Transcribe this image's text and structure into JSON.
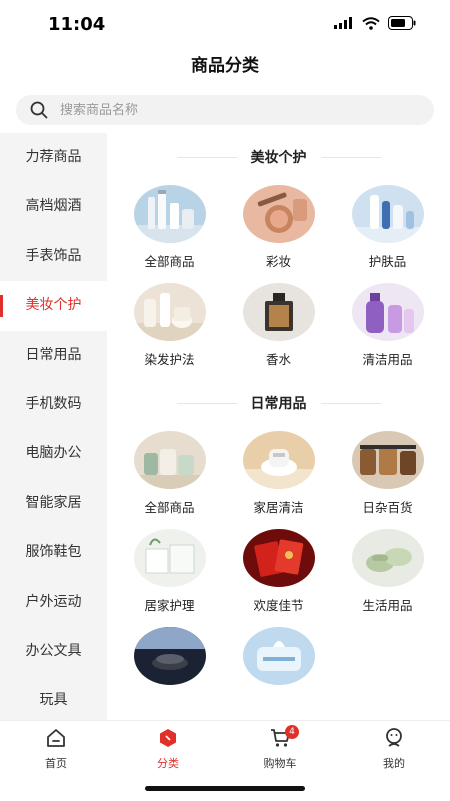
{
  "status": {
    "time": "11:04"
  },
  "header": {
    "title": "商品分类"
  },
  "search": {
    "placeholder": "搜索商品名称"
  },
  "sidebar": {
    "items": [
      {
        "label": "力荐商品"
      },
      {
        "label": "高档烟酒"
      },
      {
        "label": "手表饰品"
      },
      {
        "label": "美妆个护"
      },
      {
        "label": "日常用品"
      },
      {
        "label": "手机数码"
      },
      {
        "label": "电脑办公"
      },
      {
        "label": "智能家居"
      },
      {
        "label": "服饰鞋包"
      },
      {
        "label": "户外运动"
      },
      {
        "label": "办公文具"
      },
      {
        "label": "玩具"
      }
    ],
    "active_index": 3
  },
  "sections": [
    {
      "title": "美妆个护",
      "items": [
        {
          "label": "全部商品",
          "icon": "skincare-set-image"
        },
        {
          "label": "彩妆",
          "icon": "makeup-image"
        },
        {
          "label": "护肤品",
          "icon": "skincare-bottles-image"
        },
        {
          "label": "染发护法",
          "icon": "hair-care-image"
        },
        {
          "label": "香水",
          "icon": "perfume-image"
        },
        {
          "label": "清洁用品",
          "icon": "cleaning-products-image"
        }
      ]
    },
    {
      "title": "日常用品",
      "items": [
        {
          "label": "全部商品",
          "icon": "kitchenware-image"
        },
        {
          "label": "家居清洁",
          "icon": "mite-vacuum-image"
        },
        {
          "label": "日杂百货",
          "icon": "storage-containers-image"
        },
        {
          "label": "居家护理",
          "icon": "tissue-boxes-image"
        },
        {
          "label": "欢度佳节",
          "icon": "red-envelope-image"
        },
        {
          "label": "生活用品",
          "icon": "slippers-image"
        },
        {
          "label": "",
          "icon": "speaker-image"
        },
        {
          "label": "",
          "icon": "wet-wipes-image"
        }
      ]
    }
  ],
  "tabbar": {
    "items": [
      {
        "label": "首页",
        "icon": "home-icon"
      },
      {
        "label": "分类",
        "icon": "category-icon"
      },
      {
        "label": "购物车",
        "icon": "cart-icon",
        "badge": "4"
      },
      {
        "label": "我的",
        "icon": "profile-icon"
      }
    ],
    "active_index": 1
  },
  "colors": {
    "accent": "#e0302a",
    "sidebar_bg": "#f4f4f4",
    "search_bg": "#f2f2f2"
  }
}
